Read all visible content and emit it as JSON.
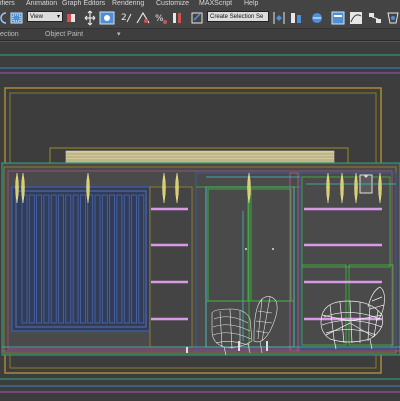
{
  "menubar": {
    "items": [
      "ifiers",
      "Animation",
      "Graph Editors",
      "Rendering",
      "Customize",
      "MAXScript",
      "Help"
    ]
  },
  "toolbar": {
    "view_dropdown": "View",
    "selection_set_dropdown": "Create Selection Se"
  },
  "ribbon": {
    "tabs": [
      "ection",
      "Object Paint"
    ],
    "extra_glyph": "▾"
  },
  "viewport": {
    "name": "front-viewport",
    "background_color": "#3d3d3d"
  },
  "colors": {
    "olive_outline": "#9a8a2a",
    "wardrobe_blue": "#3a5aa0",
    "wardrobe_fill": "#2f3a55",
    "shelf_purple": "#c48ad8",
    "green_line": "#3fbf3f",
    "cyan_line": "#3fbfbf",
    "chair_white": "#e8e8e8",
    "curtain_yellow": "#d8d08a"
  }
}
